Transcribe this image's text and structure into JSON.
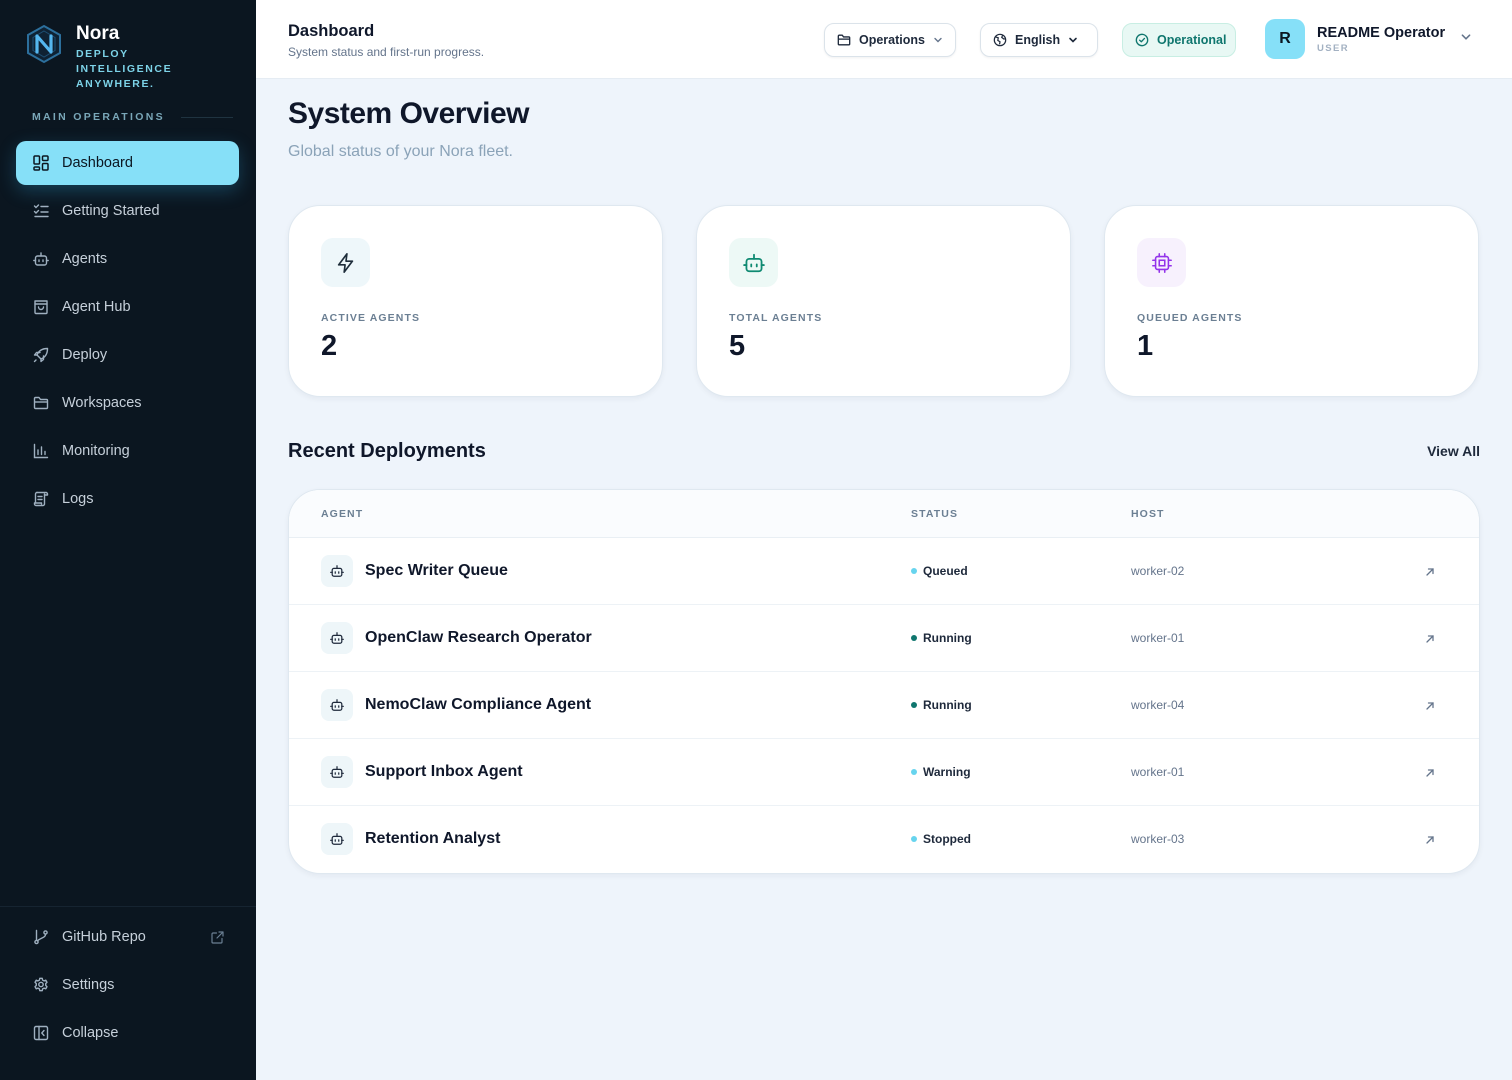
{
  "brand": {
    "name": "Nora",
    "tagline": "DEPLOY INTELLIGENCE ANYWHERE."
  },
  "sidebar": {
    "section_label": "MAIN OPERATIONS",
    "items": [
      {
        "label": "Dashboard",
        "icon": "dashboard-icon",
        "active": true
      },
      {
        "label": "Getting Started",
        "icon": "checklist-icon"
      },
      {
        "label": "Agents",
        "icon": "bot-icon"
      },
      {
        "label": "Agent Hub",
        "icon": "shopping-bag-icon"
      },
      {
        "label": "Deploy",
        "icon": "rocket-icon"
      },
      {
        "label": "Workspaces",
        "icon": "folder-icon"
      },
      {
        "label": "Monitoring",
        "icon": "bar-chart-icon"
      },
      {
        "label": "Logs",
        "icon": "scroll-icon"
      }
    ],
    "bottom": [
      {
        "label": "GitHub Repo",
        "icon": "git-branch-icon",
        "external": true
      },
      {
        "label": "Settings",
        "icon": "gear-icon"
      },
      {
        "label": "Collapse",
        "icon": "collapse-icon"
      }
    ]
  },
  "topbar": {
    "title": "Dashboard",
    "subtitle": "System status and first-run progress.",
    "workspace_select": "Operations",
    "language_select": "English",
    "status": "Operational",
    "user": {
      "initial": "R",
      "name": "README Operator",
      "role": "USER"
    }
  },
  "main": {
    "title": "System Overview",
    "subtitle": "Global status of your Nora fleet.",
    "stats": [
      {
        "label": "ACTIVE AGENTS",
        "value": "2",
        "icon": "lightning-icon"
      },
      {
        "label": "TOTAL AGENTS",
        "value": "5",
        "icon": "bot-icon"
      },
      {
        "label": "QUEUED AGENTS",
        "value": "1",
        "icon": "cpu-icon"
      }
    ],
    "deployments": {
      "title": "Recent Deployments",
      "view_all": "View All",
      "columns": [
        "AGENT",
        "STATUS",
        "HOST"
      ],
      "rows": [
        {
          "agent": "Spec Writer Queue",
          "status": "Queued",
          "host": "worker-02"
        },
        {
          "agent": "OpenClaw Research Operator",
          "status": "Running",
          "host": "worker-01"
        },
        {
          "agent": "NemoClaw Compliance Agent",
          "status": "Running",
          "host": "worker-04"
        },
        {
          "agent": "Support Inbox Agent",
          "status": "Warning",
          "host": "worker-01"
        },
        {
          "agent": "Retention Analyst",
          "status": "Stopped",
          "host": "worker-03"
        }
      ]
    }
  },
  "colors": {
    "sidebar_bg": "#0b1620",
    "accent": "#86e0f8",
    "status_running": "#0f766e",
    "status_other": "#67d4ee",
    "operational_bg": "#e8f8f4"
  }
}
